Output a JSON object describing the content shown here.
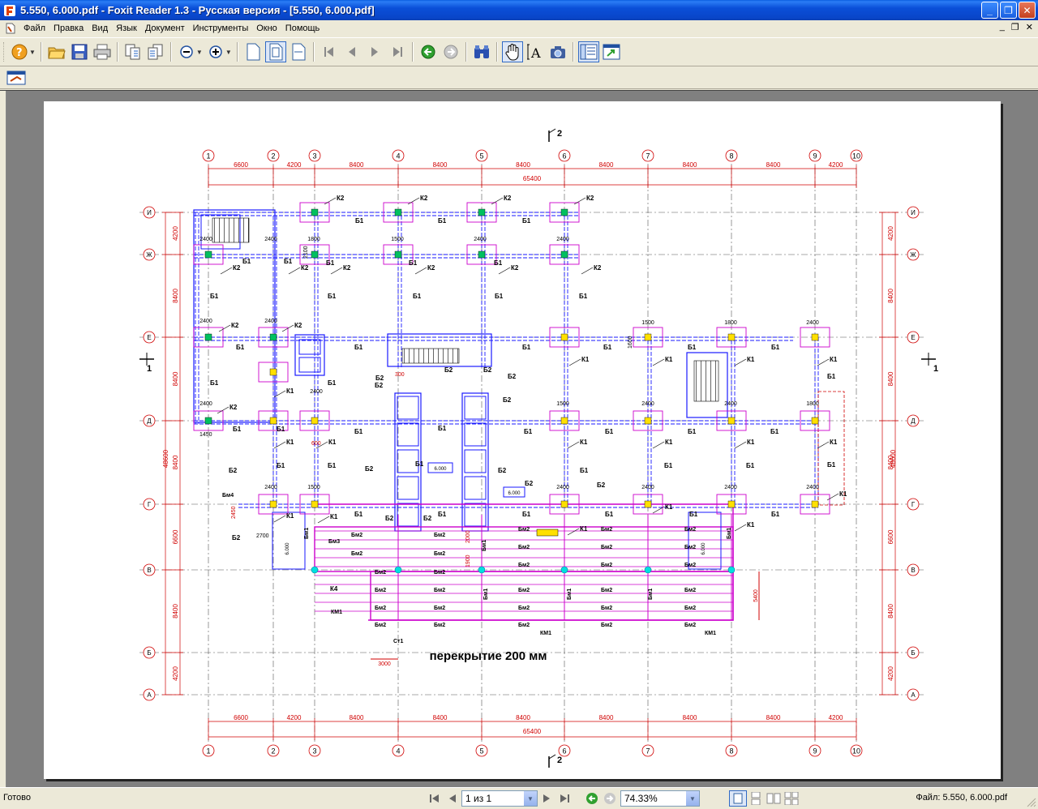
{
  "window": {
    "title": "5.550, 6.000.pdf - Foxit Reader 1.3 - Русская версия  - [5.550, 6.000.pdf]",
    "min_glyph": "_",
    "max_glyph": "❐",
    "close_glyph": "✕"
  },
  "menu": {
    "items": [
      "Файл",
      "Правка",
      "Вид",
      "Язык",
      "Документ",
      "Инструменты",
      "Окно",
      "Помощь"
    ],
    "mdi_min": "_",
    "mdi_restore": "❐",
    "mdi_close": "✕"
  },
  "status": {
    "text": "Готово",
    "page_value": "1 из 1",
    "zoom_value": "74.33%",
    "file_label": "Файл: 5.550, 6.000.pdf"
  },
  "drawing": {
    "grid_numbers": [
      "1",
      "2",
      "3",
      "4",
      "5",
      "6",
      "7",
      "8",
      "9",
      "10"
    ],
    "grid_letters": [
      "И",
      "Ж",
      "Е",
      "Д",
      "Г",
      "В",
      "Б",
      "А"
    ],
    "span_dims": [
      "6600",
      "4200",
      "8400",
      "8400",
      "8400",
      "8400",
      "8400",
      "8400",
      "4200"
    ],
    "total_width": "65400",
    "row_dims": [
      "4200",
      "8400",
      "8400",
      "8400",
      "6600",
      "8400",
      "4200"
    ],
    "total_height": "48600",
    "section_mark": "2",
    "section_mark_side": "1",
    "note": "перекрытие 200 мм",
    "labels": {
      "k1": "К1",
      "k2": "К2",
      "k4": "К4",
      "b1": "Б1",
      "b2": "Б2",
      "bm1": "Бм1",
      "bm2": "Бм2",
      "bm3": "Бм3",
      "bm4": "Бм4",
      "km1": "КМ1",
      "st1": "Ст1",
      "elev": "6.000",
      "d2400": "2400",
      "d1800": "1800",
      "d1500": "1500",
      "d2100": "2100",
      "d1600": "1600",
      "d2700": "2700",
      "d3000": "3000",
      "d5400": "5400",
      "d2450": "2450",
      "d1450": "1450",
      "d600": "600",
      "d300": "300",
      "d1900": "1900",
      "d2000": "2000"
    }
  },
  "colors": {
    "titlebar": "#0a4fd8",
    "grid": "#d00000",
    "beam": "#1a1aff",
    "slab": "#cc00cc",
    "column_green": "#00c060",
    "column_yellow": "#ffe000",
    "column_cyan": "#00e0e0"
  }
}
